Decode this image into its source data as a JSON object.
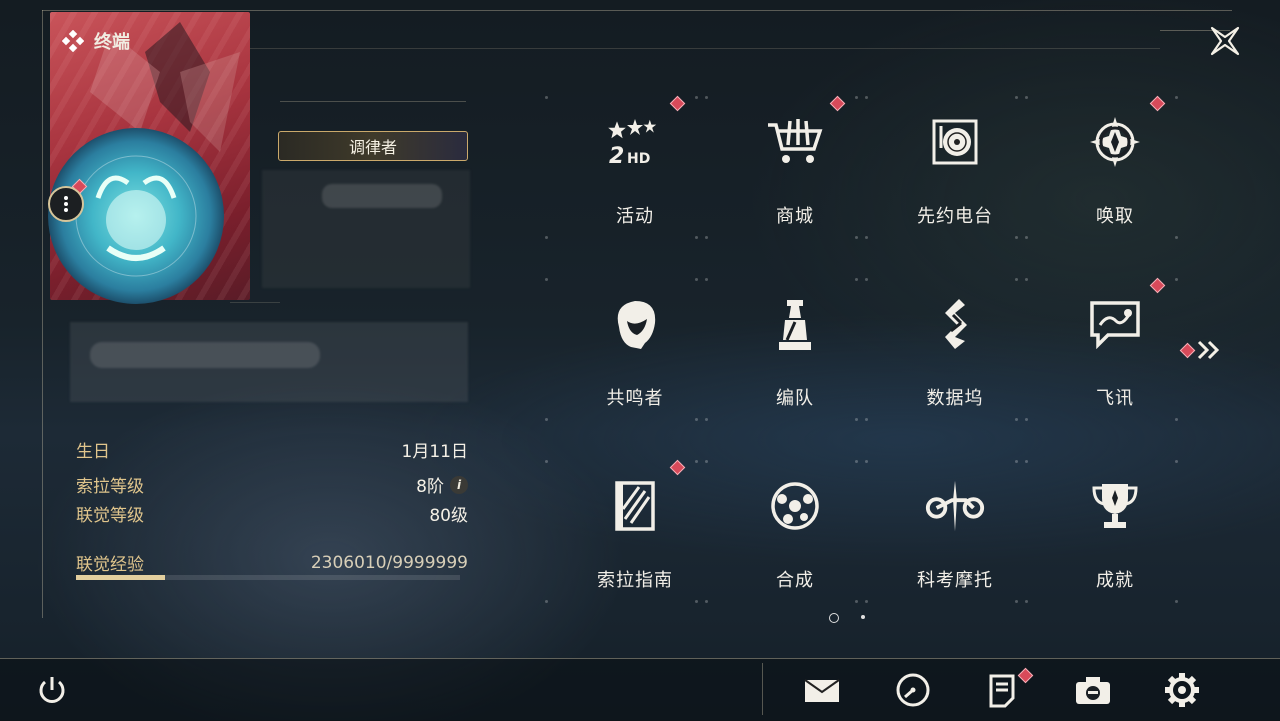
{
  "header": {
    "title": "终端"
  },
  "profile": {
    "title_badge": "调律者",
    "stats": [
      {
        "label": "生日",
        "value": "1月11日"
      },
      {
        "label": "索拉等级",
        "value": "8阶"
      },
      {
        "label": "联觉等级",
        "value": "80级"
      },
      {
        "label": "联觉经验",
        "value": "2306010/9999999"
      }
    ],
    "xp_fraction": 0.2306
  },
  "menu": {
    "items": [
      {
        "label": "活动",
        "icon": "activity-2hd-icon",
        "badge": true
      },
      {
        "label": "商城",
        "icon": "shop-cart-icon",
        "badge": true
      },
      {
        "label": "先约电台",
        "icon": "radio-record-icon",
        "badge": false
      },
      {
        "label": "唤取",
        "icon": "convene-compass-icon",
        "badge": true
      },
      {
        "label": "共鸣者",
        "icon": "resonator-head-icon",
        "badge": false
      },
      {
        "label": "编队",
        "icon": "team-chess-icon",
        "badge": false
      },
      {
        "label": "数据坞",
        "icon": "data-dock-icon",
        "badge": false
      },
      {
        "label": "飞讯",
        "icon": "message-chat-icon",
        "badge": true
      },
      {
        "label": "索拉指南",
        "icon": "guide-book-icon",
        "badge": true
      },
      {
        "label": "合成",
        "icon": "synthesis-icon",
        "badge": false
      },
      {
        "label": "科考摩托",
        "icon": "motorcycle-icon",
        "badge": false
      },
      {
        "label": "成就",
        "icon": "trophy-icon",
        "badge": false
      }
    ],
    "next_page_icon": "double-chevron-right-icon",
    "pages": 2,
    "current_page": 1
  },
  "bottom_bar": {
    "icons": [
      "power-icon",
      "mail-icon",
      "clock-icon",
      "notice-icon",
      "camera-icon",
      "settings-gear-icon"
    ]
  },
  "colors": {
    "accent_gold": "#e0c58c",
    "badge_red": "#d84a5a",
    "card_red": "#b23a47"
  }
}
